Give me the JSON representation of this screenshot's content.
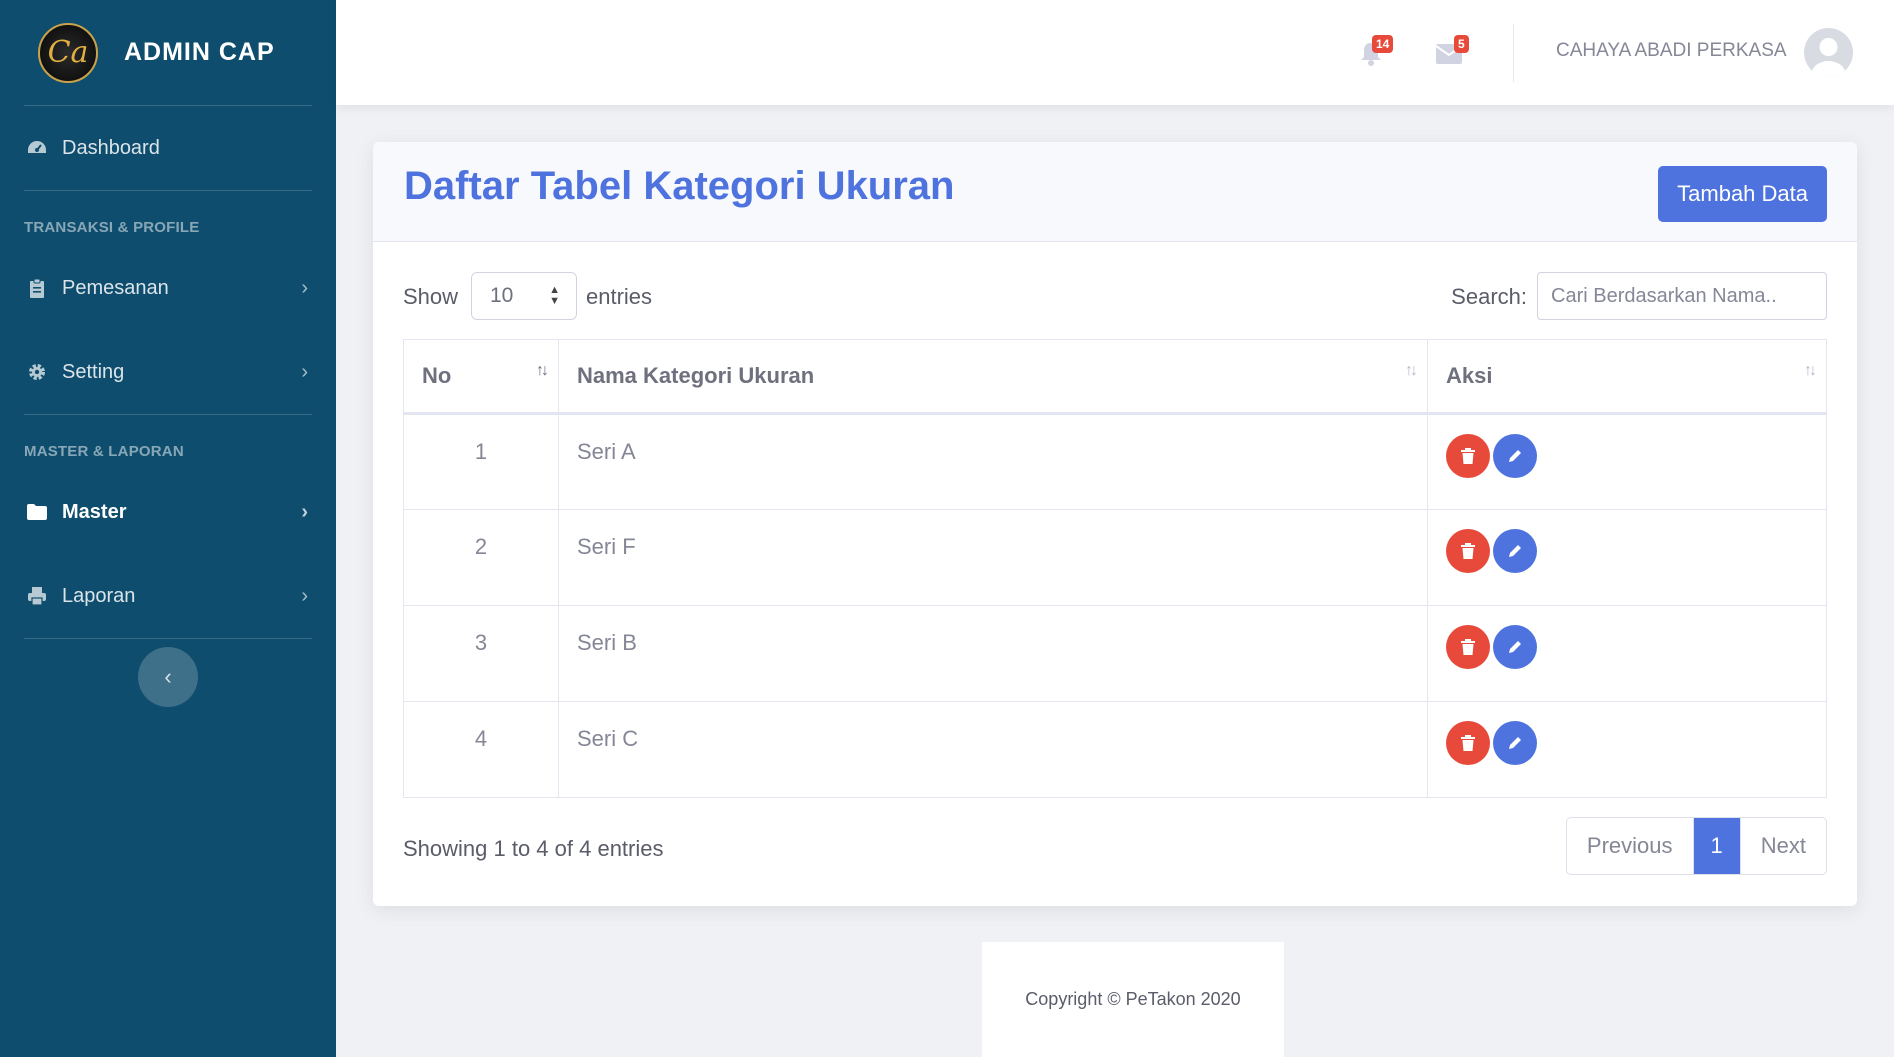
{
  "sidebar": {
    "brand": "ADMIN CAP",
    "logo_text": "Ca",
    "items": [
      {
        "label": "Dashboard",
        "icon": "dashboard-icon"
      },
      {
        "label": "Pemesanan",
        "icon": "clipboard-icon"
      },
      {
        "label": "Setting",
        "icon": "gear-icon"
      },
      {
        "label": "Master",
        "icon": "folder-icon",
        "active": true
      },
      {
        "label": "Laporan",
        "icon": "printer-icon"
      }
    ],
    "section1": "TRANSAKSI & PROFILE",
    "section2": "MASTER & LAPORAN"
  },
  "topbar": {
    "alerts_count": "14",
    "messages_count": "5",
    "user_name": "CAHAYA ABADI PERKASA"
  },
  "card": {
    "title": "Daftar Tabel Kategori Ukuran",
    "add_button": "Tambah Data"
  },
  "controls": {
    "show_label": "Show",
    "entries_value": "10",
    "entries_label": "entries",
    "search_label": "Search:",
    "search_placeholder": "Cari Berdasarkan Nama.."
  },
  "table": {
    "headers": [
      "No",
      "Nama Kategori Ukuran",
      "Aksi"
    ],
    "rows": [
      {
        "no": "1",
        "name": "Seri A"
      },
      {
        "no": "2",
        "name": "Seri F"
      },
      {
        "no": "3",
        "name": "Seri B"
      },
      {
        "no": "4",
        "name": "Seri C"
      }
    ]
  },
  "pagination": {
    "info": "Showing 1 to 4 of 4 entries",
    "previous": "Previous",
    "current": "1",
    "next": "Next"
  },
  "footer": {
    "copyright": "Copyright © PeTakon 2020"
  },
  "colors": {
    "sidebar": "#0e4d6d",
    "primary": "#4e73df",
    "danger": "#e74a3b"
  }
}
